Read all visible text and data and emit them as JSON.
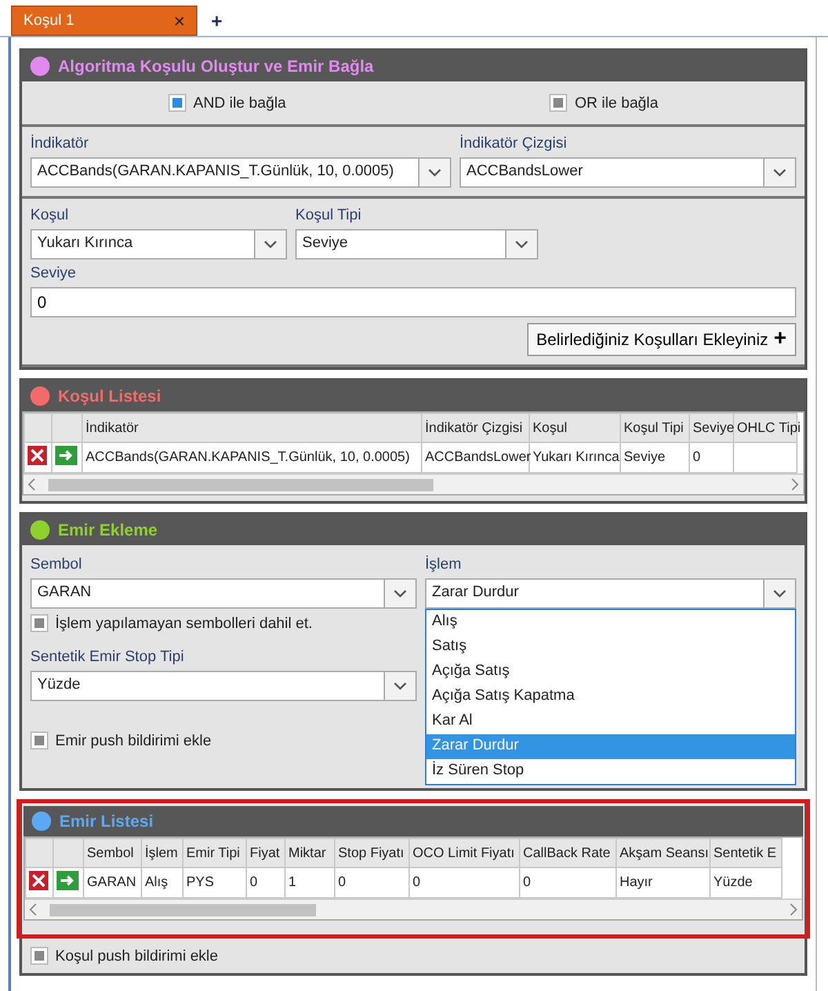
{
  "tabs": [
    {
      "label": "Koşul 1",
      "selected": true,
      "close": "×"
    }
  ],
  "add_tab": "+",
  "condition_builder": {
    "title": "Algoritma Koşulu Oluştur ve Emir Bağla",
    "color": "#e08af0",
    "logic": [
      {
        "label": "AND ile bağla",
        "checked": true
      },
      {
        "label": "OR ile bağla",
        "checked": false
      }
    ],
    "indicator": {
      "label": "İndikatör",
      "value": "ACCBands(GARAN.KAPANIS_T.Günlük, 10, 0.0005)"
    },
    "indicator_line": {
      "label": "İndikatör Çizgisi",
      "value": "ACCBandsLower"
    },
    "condition": {
      "label": "Koşul",
      "value": "Yukarı Kırınca"
    },
    "condition_type": {
      "label": "Koşul Tipi",
      "value": "Seviye"
    },
    "level": {
      "label": "Seviye",
      "value": "0"
    },
    "add_button": {
      "label": "Belirlediğiniz Koşulları Ekleyiniz",
      "icon": "+"
    }
  },
  "condition_list": {
    "title": "Koşul Listesi",
    "color": "#f26b6b",
    "columns": [
      "İndikatör",
      "İndikatör Çizgisi",
      "Koşul",
      "Koşul Tipi",
      "Seviye",
      "OHLC Tipi"
    ],
    "rows": [
      [
        "ACCBands(GARAN.KAPANIS_T.Günlük, 10, 0.0005)",
        "ACCBandsLower",
        "Yukarı Kırınca",
        "Seviye",
        "0",
        ""
      ]
    ]
  },
  "order_entry": {
    "title": "Emir Ekleme",
    "color": "#8fd12c",
    "symbol": {
      "label": "Sembol",
      "value": "GARAN"
    },
    "include_untradable": {
      "label": "İşlem yapılamayan sembolleri dahil et.",
      "checked": false
    },
    "stop_type": {
      "label": "Sentetik Emir Stop Tipi",
      "value": "Yüzde"
    },
    "push": {
      "label": "Emir push bildirimi ekle",
      "checked": false
    },
    "action": {
      "label": "İşlem",
      "value": "Zarar Durdur",
      "expanded": true,
      "options": [
        {
          "label": "Alış",
          "selected": false
        },
        {
          "label": "Satış",
          "selected": false
        },
        {
          "label": "Açığa Satış",
          "selected": false
        },
        {
          "label": "Açığa Satış Kapatma",
          "selected": false
        },
        {
          "label": "Kar Al",
          "selected": false
        },
        {
          "label": "Zarar Durdur",
          "selected": true
        },
        {
          "label": "İz Süren Stop",
          "selected": false
        }
      ]
    }
  },
  "order_list": {
    "title": "Emir Listesi",
    "color": "#5aa9f2",
    "highlighted": true,
    "columns": [
      "Sembol",
      "İşlem",
      "Emir Tipi",
      "Fiyat",
      "Miktar",
      "Stop Fiyatı",
      "OCO Limit Fiyatı",
      "CallBack Rate",
      "Akşam Seansı",
      "Sentetik E"
    ],
    "rows": [
      [
        "GARAN",
        "Alış",
        "PYS",
        "0",
        "1",
        "0",
        "0",
        "0",
        "Hayır",
        "Yüzde"
      ]
    ]
  },
  "condition_push": {
    "label": "Koşul push bildirimi ekle",
    "checked": false
  }
}
